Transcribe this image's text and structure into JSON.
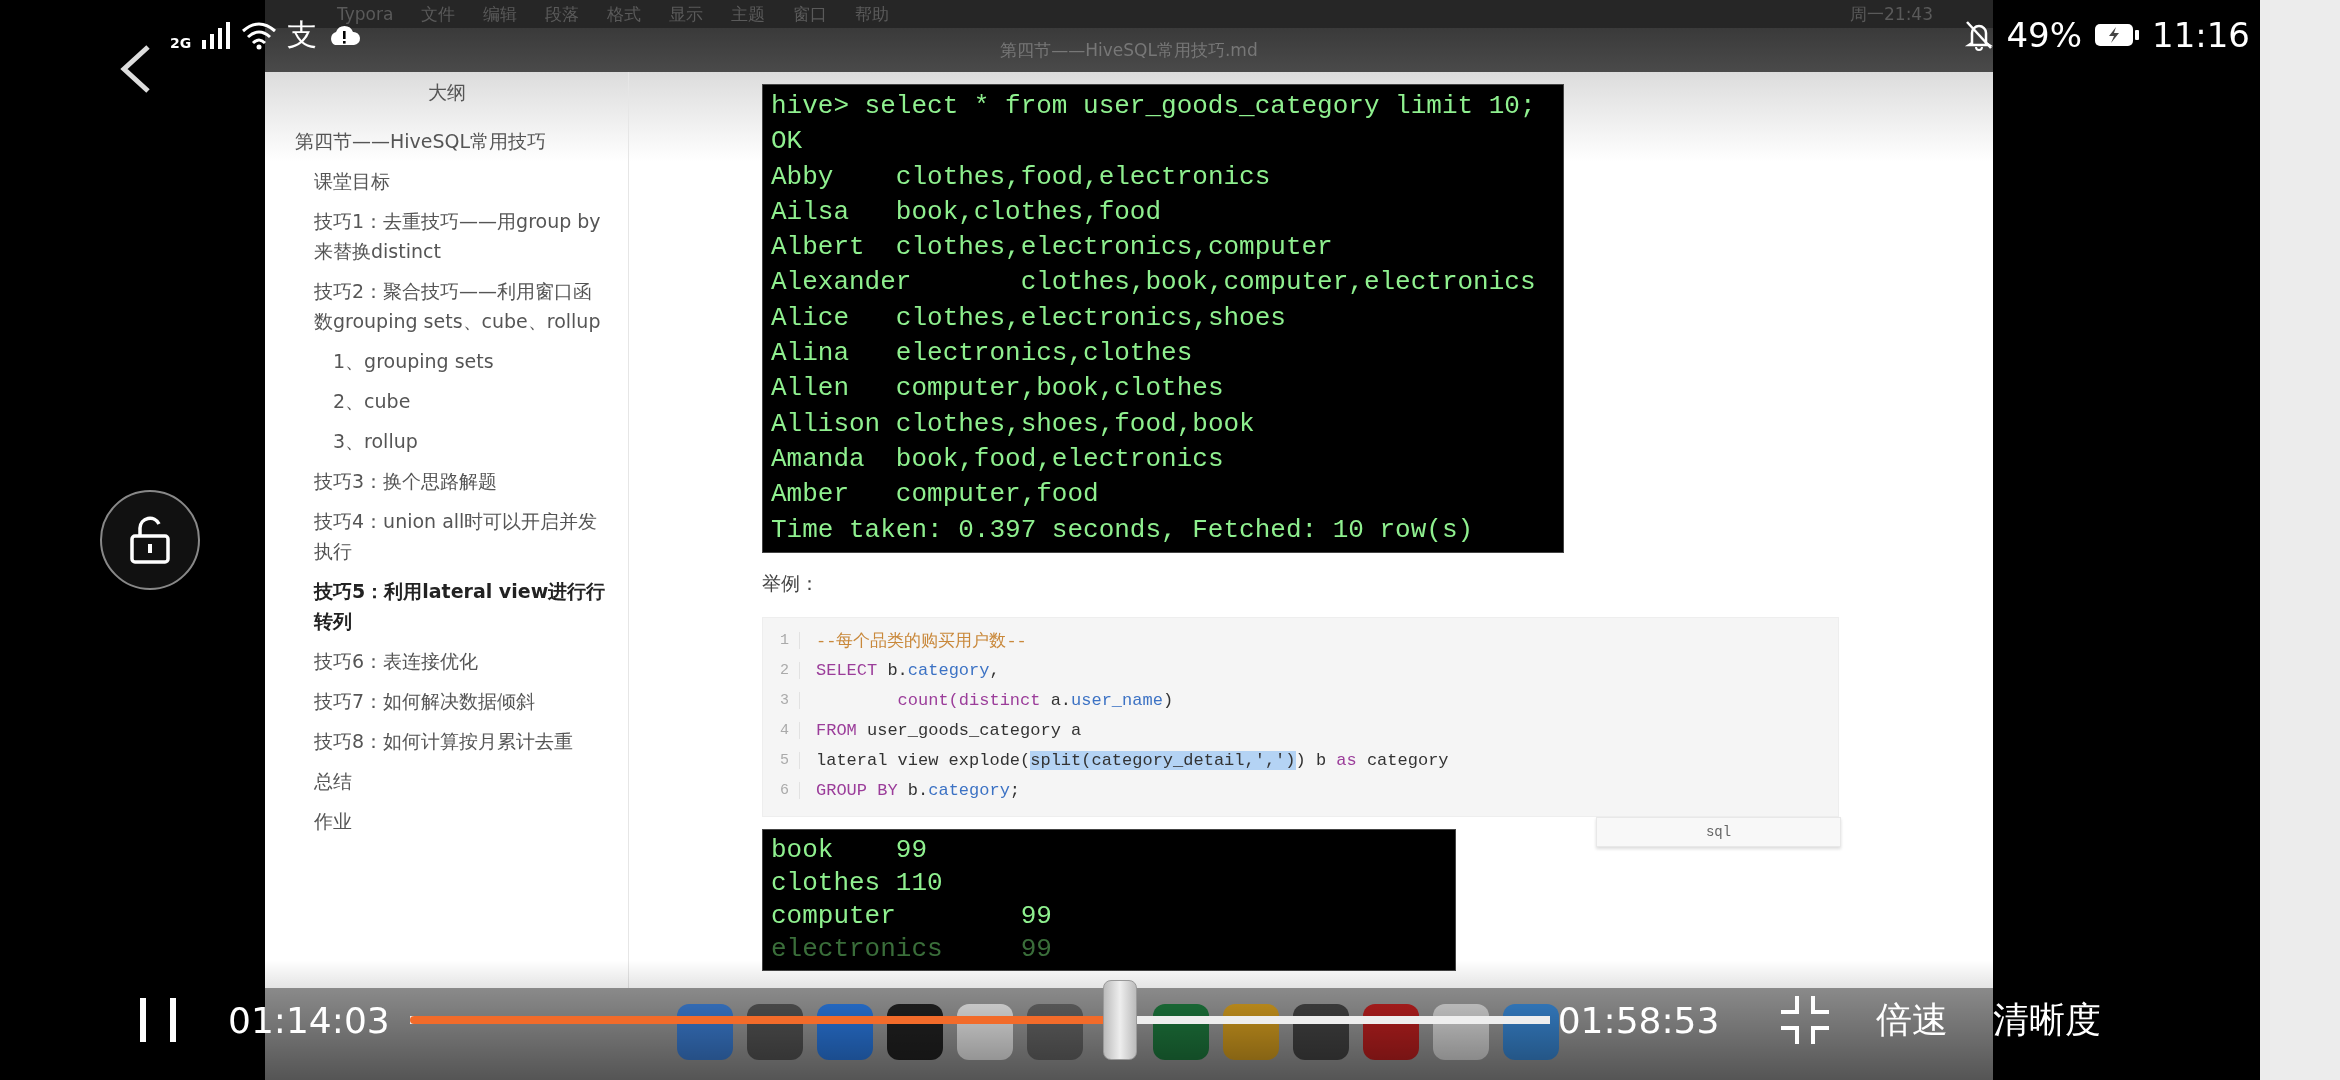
{
  "status_bar": {
    "network": "2G",
    "app_badge": "支",
    "battery": "49%",
    "time": "11:16"
  },
  "typora": {
    "menu": [
      "Typora",
      "文件",
      "编辑",
      "段落",
      "格式",
      "显示",
      "主题",
      "窗口",
      "帮助"
    ],
    "clock": "周一21:43",
    "document_title": "第四节——HiveSQL常用技巧.md",
    "outline": {
      "title": "大纲",
      "items": [
        {
          "text": "第四节——HiveSQL常用技巧",
          "selected": false,
          "children": [
            {
              "text": "课堂目标",
              "selected": false
            },
            {
              "text": "技巧1：去重技巧——用group by来替换distinct",
              "selected": false
            },
            {
              "text": "技巧2：聚合技巧——利用窗口函数grouping sets、cube、rollup",
              "selected": false,
              "children": [
                {
                  "text": "1、grouping sets",
                  "selected": false
                },
                {
                  "text": "2、cube",
                  "selected": false
                },
                {
                  "text": "3、rollup",
                  "selected": false
                }
              ]
            },
            {
              "text": "技巧3：换个思路解题",
              "selected": false
            },
            {
              "text": "技巧4：union all时可以开启并发执行",
              "selected": false
            },
            {
              "text": "技巧5：利用lateral view进行行转列",
              "selected": true
            },
            {
              "text": "技巧6：表连接优化",
              "selected": false
            },
            {
              "text": "技巧7：如何解决数据倾斜",
              "selected": false
            },
            {
              "text": "技巧8：如何计算按月累计去重",
              "selected": false
            },
            {
              "text": "总结",
              "selected": false
            },
            {
              "text": "作业",
              "selected": false
            }
          ]
        }
      ]
    },
    "terminal_output": [
      "hive> select * from user_goods_category limit 10;",
      "OK",
      "Abby\tclothes,food,electronics",
      "Ailsa\tbook,clothes,food",
      "Albert\tclothes,electronics,computer",
      "Alexander\tclothes,book,computer,electronics",
      "Alice\tclothes,electronics,shoes",
      "Alina\telectronics,clothes",
      "Allen\tcomputer,book,clothes",
      "Allison\tclothes,shoes,food,book",
      "Amanda\tbook,food,electronics",
      "Amber\tcomputer,food",
      "Time taken: 0.397 seconds, Fetched: 10 row(s)"
    ],
    "example_label": "举例：",
    "code_block": {
      "language": "sql",
      "lines": [
        {
          "number": "1",
          "tokens": [
            {
              "text": "--每个品类的购买用户数--",
              "kind": "comment"
            }
          ]
        },
        {
          "number": "2",
          "tokens": [
            {
              "text": "SELECT",
              "kind": "keyword"
            },
            {
              "text": " b.",
              "kind": "plain"
            },
            {
              "text": "category",
              "kind": "property"
            },
            {
              "text": ",",
              "kind": "plain"
            }
          ]
        },
        {
          "number": "3",
          "tokens": [
            {
              "text": "        count(distinct",
              "kind": "keyword"
            },
            {
              "text": " a.",
              "kind": "plain"
            },
            {
              "text": "user_name",
              "kind": "property"
            },
            {
              "text": ")",
              "kind": "plain"
            }
          ]
        },
        {
          "number": "4",
          "tokens": [
            {
              "text": "FROM",
              "kind": "keyword"
            },
            {
              "text": " user_goods_category a",
              "kind": "plain"
            }
          ]
        },
        {
          "number": "5",
          "tokens": [
            {
              "text": "lateral view explode(",
              "kind": "plain"
            },
            {
              "text": "split(category_detail,',')",
              "kind": "selected"
            },
            {
              "text": ") b ",
              "kind": "plain"
            },
            {
              "text": "as",
              "kind": "keyword"
            },
            {
              "text": " category",
              "kind": "plain"
            }
          ]
        },
        {
          "number": "6",
          "tokens": [
            {
              "text": "GROUP BY",
              "kind": "keyword"
            },
            {
              "text": " b.",
              "kind": "plain"
            },
            {
              "text": "category",
              "kind": "property"
            },
            {
              "text": ";",
              "kind": "plain"
            }
          ]
        }
      ]
    },
    "result_output": [
      "book\t99",
      "clothes 110",
      "computer\t99",
      "electronics\t99"
    ]
  },
  "player": {
    "playing": true,
    "elapsed": "01:14:03",
    "level": 0.623,
    "total": "01:58:53",
    "speed": "倍速",
    "quality": "清晰度"
  }
}
